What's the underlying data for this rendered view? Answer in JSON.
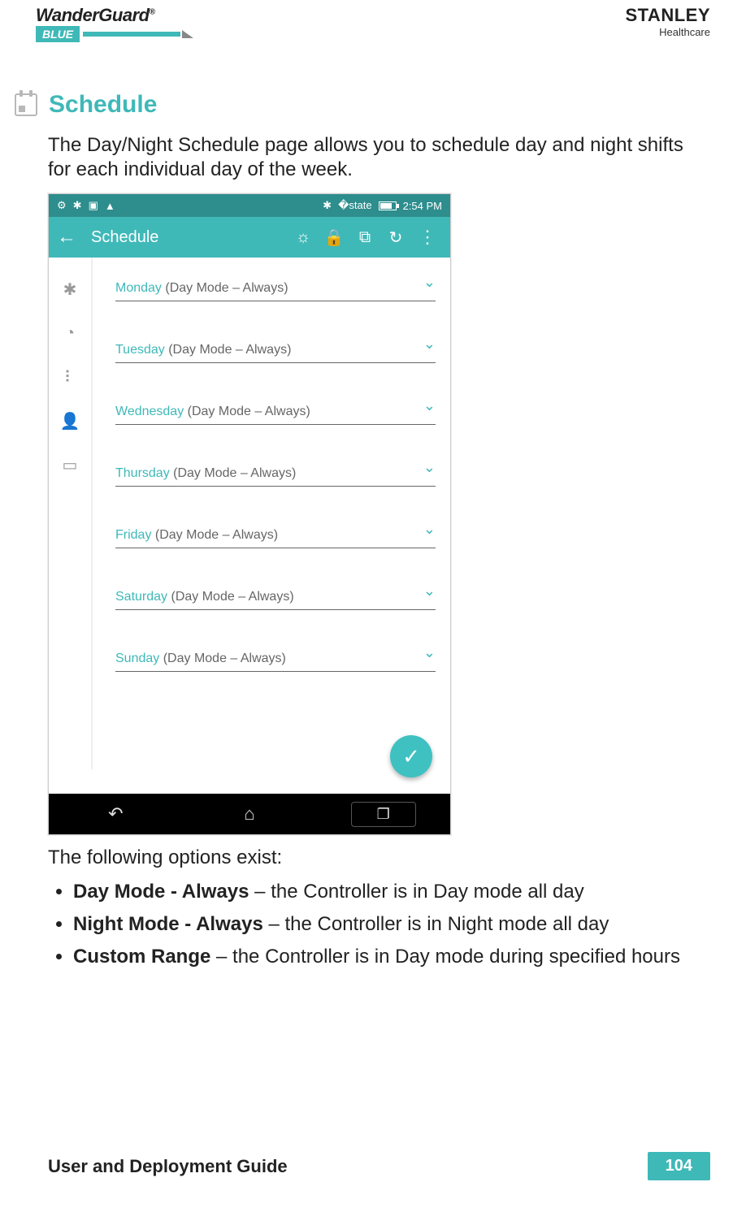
{
  "header": {
    "left_logo_top": "WanderGuard",
    "left_logo_reg": "®",
    "left_logo_sub": "BLUE",
    "right_logo_top": "STANLEY",
    "right_logo_sub": "Healthcare"
  },
  "section": {
    "title": "Schedule",
    "icon": "calendar-icon",
    "intro": "The Day/Night Schedule page allows you to schedule day and night shifts for each individual day of the week."
  },
  "device": {
    "statusbar": {
      "left_icons": [
        "globe-icon",
        "bluetooth-icon",
        "image-icon",
        "warning-icon"
      ],
      "right_icons": [
        "bluetooth-icon",
        "wifi-icon",
        "battery-icon"
      ],
      "time": "2:54 PM"
    },
    "appbar": {
      "back_icon": "back-arrow-icon",
      "title": "Schedule",
      "actions": [
        "brightness-icon",
        "lock-icon",
        "crop-icon",
        "refresh-icon"
      ],
      "overflow": "overflow-menu-icon"
    },
    "rail_icons": [
      "gear-icon",
      "clock-icon",
      "node-icon",
      "person-icon",
      "calendar-icon"
    ],
    "rows": [
      {
        "day": "Monday",
        "mode": " (Day Mode – Always)"
      },
      {
        "day": "Tuesday",
        "mode": " (Day Mode – Always)"
      },
      {
        "day": "Wednesday",
        "mode": " (Day Mode – Always)"
      },
      {
        "day": "Thursday",
        "mode": " (Day Mode – Always)"
      },
      {
        "day": "Friday",
        "mode": " (Day Mode – Always)"
      },
      {
        "day": "Saturday",
        "mode": " (Day Mode – Always)"
      },
      {
        "day": "Sunday",
        "mode": " (Day Mode – Always)"
      }
    ],
    "fab_icon": "check-icon",
    "navbar": [
      "android-back-icon",
      "android-home-icon",
      "android-recent-icon"
    ]
  },
  "options_heading": "The following options exist:",
  "options": [
    {
      "b": "Day Mode - Always",
      "rest": " – the Controller is in Day mode all day"
    },
    {
      "b": "Night Mode - Always",
      "rest": " – the Controller is in Night mode all day"
    },
    {
      "b": "Custom Range",
      "rest": " – the Controller is in Day mode during specified hours"
    }
  ],
  "footer": {
    "guide": "User and Deployment Guide",
    "page": "104"
  }
}
